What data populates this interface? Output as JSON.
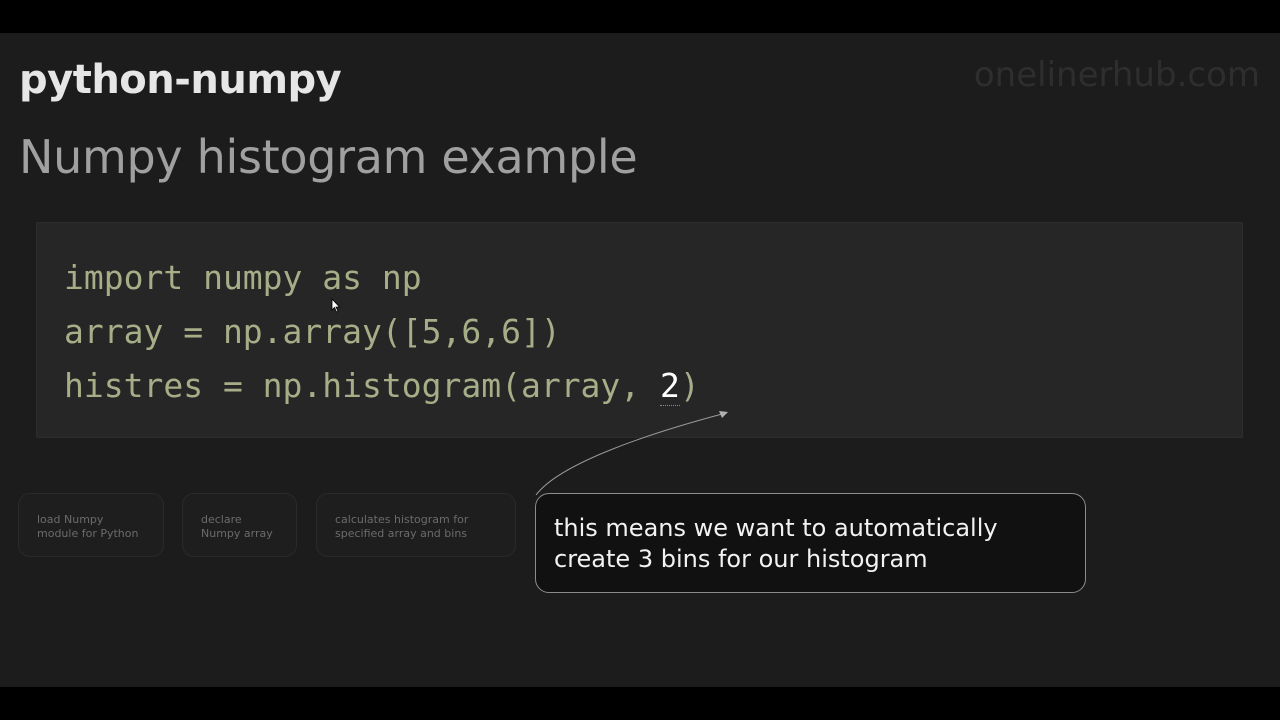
{
  "header": {
    "title": "python-numpy",
    "site": "onelinerhub.com",
    "subtitle": "Numpy histogram example"
  },
  "code": {
    "line1": "import numpy as np",
    "line2": "array = np.array([5,6,6])",
    "line3_before": "histres = np.histogram(array, ",
    "line3_highlight": "2",
    "line3_after": ")"
  },
  "hints": [
    {
      "line1": "load Numpy",
      "line2": "module for Python"
    },
    {
      "line1": "declare",
      "line2": "Numpy array"
    },
    {
      "line1": "calculates histogram for",
      "line2": "specified array and bins"
    }
  ],
  "callout": {
    "line1": "this means we want to automatically",
    "line2": "create 3 bins for our histogram"
  },
  "icons": {
    "cursor": "mouse-pointer-icon",
    "arrow": "annotation-arrow"
  },
  "colors": {
    "background": "#1c1c1c",
    "code_text": "#a6ae88",
    "highlight": "#ffffff"
  }
}
